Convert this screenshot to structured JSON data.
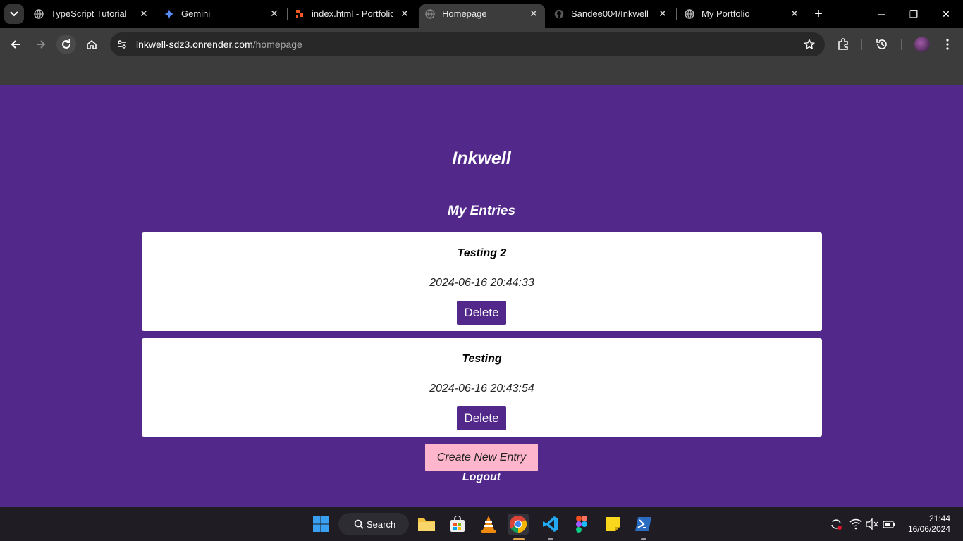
{
  "browser": {
    "tabs": [
      {
        "title": "TypeScript Tutorial",
        "icon": "globe-icon"
      },
      {
        "title": "Gemini",
        "icon": "gemini-star-icon"
      },
      {
        "title": "index.html - Portfolio",
        "icon": "figma-like-icon"
      },
      {
        "title": "Homepage",
        "icon": "globe-icon",
        "active": true
      },
      {
        "title": "Sandee004/Inkwell",
        "icon": "github-icon"
      },
      {
        "title": "My Portfolio",
        "icon": "globe-icon"
      }
    ],
    "address": {
      "host": "inkwell-sdz3.onrender.com",
      "path": "/homepage"
    },
    "accent": "#52288a"
  },
  "page": {
    "brand": "Inkwell",
    "section_title": "My Entries",
    "entries": [
      {
        "title": "Testing 2",
        "date": "2024-06-16 20:44:33",
        "delete_label": "Delete"
      },
      {
        "title": "Testing",
        "date": "2024-06-16 20:43:54",
        "delete_label": "Delete"
      }
    ],
    "create_label": "Create New Entry",
    "logout_label": "Logout",
    "background": "#52288a",
    "create_color": "#ffb6cc"
  },
  "taskbar": {
    "search_label": "Search",
    "time": "21:44",
    "date": "16/06/2024"
  }
}
